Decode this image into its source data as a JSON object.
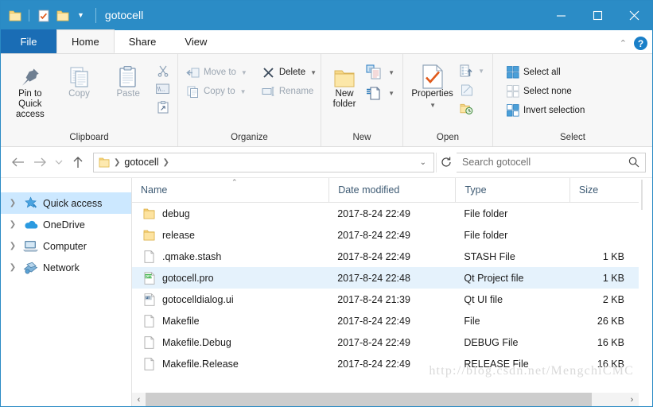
{
  "window": {
    "title": "gotocell",
    "quick_access": [
      "folder-icon",
      "separator",
      "properties-icon",
      "new-folder-icon",
      "chevron-down-icon"
    ],
    "controls": {
      "minimize": "minimize-icon",
      "maximize": "maximize-icon",
      "close": "close-icon"
    },
    "titlebar_color": "#2b8cc6"
  },
  "tabs": [
    {
      "label": "File",
      "id": "file",
      "active": false,
      "style": "file"
    },
    {
      "label": "Home",
      "id": "home",
      "active": true
    },
    {
      "label": "Share",
      "id": "share",
      "active": false
    },
    {
      "label": "View",
      "id": "view",
      "active": false
    }
  ],
  "tabbar_right": {
    "collapse": "chevron-up-icon",
    "help": "?"
  },
  "ribbon": {
    "groups": [
      {
        "label": "Clipboard",
        "big_buttons": [
          {
            "label": "Pin to Quick\naccess",
            "line1": "Pin to Quick",
            "line2": "access",
            "icon": "pushpin-icon",
            "dim": false
          },
          {
            "label": "Copy",
            "icon": "copy-icon",
            "dim": true
          },
          {
            "label": "Paste",
            "icon": "paste-icon",
            "dim": true
          }
        ],
        "small_buttons": [
          {
            "label": "",
            "icon": "cut-scissors-icon",
            "dim": true
          },
          {
            "label": "",
            "icon": "copy-path-icon",
            "dim": true
          },
          {
            "label": "",
            "icon": "paste-shortcut-icon",
            "dim": true
          }
        ]
      },
      {
        "label": "Organize",
        "small_buttons": [
          {
            "label": "Move to",
            "icon": "move-to-icon",
            "dim": true,
            "caret": true
          },
          {
            "label": "Copy to",
            "icon": "copy-to-icon",
            "dim": true,
            "caret": true
          },
          {
            "label": "Delete",
            "icon": "delete-x-icon",
            "dim": false,
            "caret": true
          },
          {
            "label": "Rename",
            "icon": "rename-icon",
            "dim": true,
            "caret": false
          }
        ]
      },
      {
        "label": "New",
        "big_buttons": [
          {
            "line1": "New",
            "line2": "folder",
            "icon": "new-folder-icon",
            "dim": false
          }
        ],
        "small_buttons": [
          {
            "label": "",
            "icon": "new-item-icon",
            "dim": false,
            "caret": true
          },
          {
            "label": "",
            "icon": "easy-access-icon",
            "dim": false,
            "caret": true
          }
        ]
      },
      {
        "label": "Open",
        "big_buttons": [
          {
            "line1": "Properties",
            "line2": "",
            "icon": "properties-check-icon",
            "dim": false,
            "caret": true
          }
        ],
        "small_buttons": [
          {
            "label": "",
            "icon": "open-icon",
            "dim": true,
            "caret": true
          },
          {
            "label": "",
            "icon": "edit-icon",
            "dim": true
          },
          {
            "label": "",
            "icon": "history-icon",
            "dim": false
          }
        ]
      },
      {
        "label": "Select",
        "small_buttons": [
          {
            "label": "Select all",
            "icon": "select-all-icon",
            "dim": false
          },
          {
            "label": "Select none",
            "icon": "select-none-icon",
            "dim": false
          },
          {
            "label": "Invert selection",
            "icon": "invert-selection-icon",
            "dim": false
          }
        ]
      }
    ]
  },
  "addressbar": {
    "back": "arrow-left-icon",
    "forward": "arrow-right-icon",
    "recent": "chevron-down-icon",
    "up": "arrow-up-icon",
    "breadcrumb": {
      "folder_icon": "folder-icon",
      "path": "gotocell"
    },
    "dropdown": "chevron-down-icon",
    "refresh": "refresh-icon",
    "search": {
      "placeholder": "Search gotocell",
      "value": "",
      "icon": "search-icon"
    }
  },
  "navpane": {
    "items": [
      {
        "label": "Quick access",
        "icon": "star-icon",
        "selected": true
      },
      {
        "label": "OneDrive",
        "icon": "cloud-icon",
        "selected": false
      },
      {
        "label": "Computer",
        "icon": "computer-icon",
        "selected": false
      },
      {
        "label": "Network",
        "icon": "network-icon",
        "selected": false
      }
    ]
  },
  "filelist": {
    "columns": [
      {
        "label": "Name",
        "sorted": "asc"
      },
      {
        "label": "Date modified"
      },
      {
        "label": "Type"
      },
      {
        "label": "Size"
      }
    ],
    "rows": [
      {
        "name": "debug",
        "date": "2017-8-24 22:49",
        "type": "File folder",
        "size": "",
        "icon": "folder-icon",
        "selected": false
      },
      {
        "name": "release",
        "date": "2017-8-24 22:49",
        "type": "File folder",
        "size": "",
        "icon": "folder-icon",
        "selected": false
      },
      {
        "name": ".qmake.stash",
        "date": "2017-8-24 22:49",
        "type": "STASH File",
        "size": "1 KB",
        "icon": "file-icon",
        "selected": false
      },
      {
        "name": "gotocell.pro",
        "date": "2017-8-24 22:48",
        "type": "Qt Project file",
        "size": "1 KB",
        "icon": "pro-file-icon",
        "selected": true
      },
      {
        "name": "gotocelldialog.ui",
        "date": "2017-8-24 21:39",
        "type": "Qt UI file",
        "size": "2 KB",
        "icon": "ui-file-icon",
        "selected": false
      },
      {
        "name": "Makefile",
        "date": "2017-8-24 22:49",
        "type": "File",
        "size": "26 KB",
        "icon": "file-icon",
        "selected": false
      },
      {
        "name": "Makefile.Debug",
        "date": "2017-8-24 22:49",
        "type": "DEBUG File",
        "size": "16 KB",
        "icon": "file-icon",
        "selected": false
      },
      {
        "name": "Makefile.Release",
        "date": "2017-8-24 22:49",
        "type": "RELEASE File",
        "size": "16 KB",
        "icon": "file-icon",
        "selected": false
      }
    ]
  },
  "watermark": "http://blog.csdn.net/MengchiCMC",
  "scrollbar": {
    "left_arrow": "‹",
    "right_arrow": "›"
  }
}
